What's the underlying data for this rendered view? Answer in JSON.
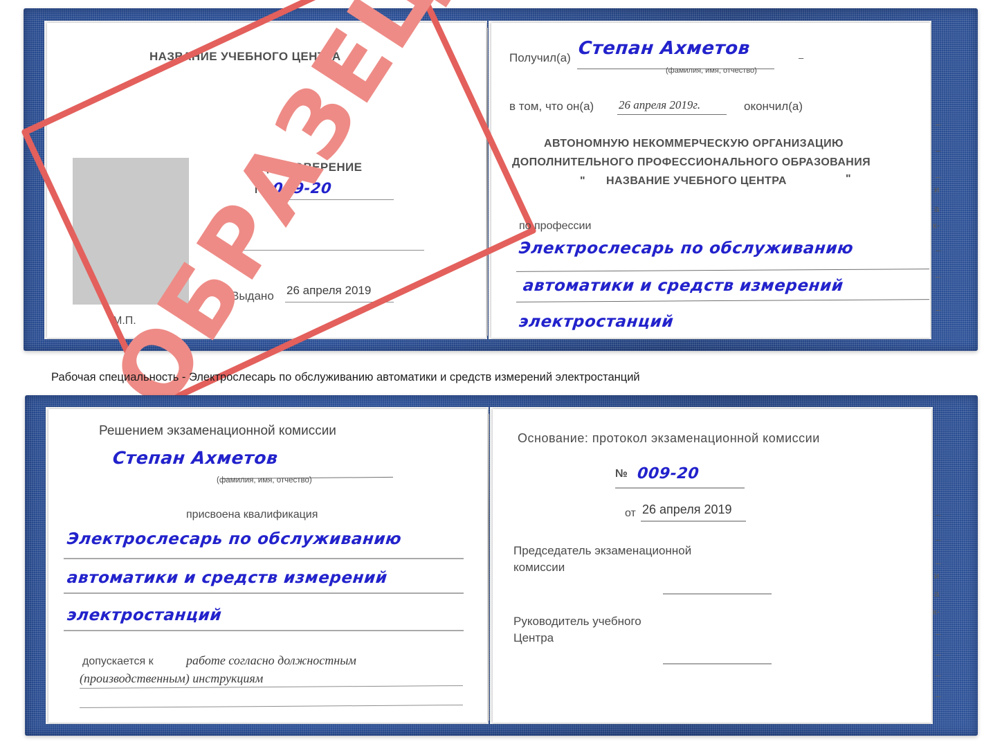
{
  "meta": {
    "document_type": "Удостоверение",
    "stamp_text": "ОБРАЗЕЦ",
    "accent_blue": "#2b5098",
    "stamp_red": "#e3605c",
    "handwriting_blue": "#2222cc"
  },
  "caption": "Рабочая специальность - Электрослесарь по обслуживанию автоматики и средств измерений электростанций",
  "certificate_1": {
    "left_page": {
      "center_name": "НАЗВАНИЕ УЧЕБНОГО ЦЕНТРА",
      "doc_title": "УДОСТОВЕРЕНИЕ",
      "number_label": "№",
      "number_value": "009-20",
      "issued_label": "Выдано",
      "issued_value": "26 апреля 2019",
      "seal_label": "М.П.",
      "photo_placeholder": "photo-placeholder"
    },
    "right_page": {
      "received_label": "Получил(а)",
      "received_value": "Степан Ахметов",
      "fio_hint": "(фамилия, имя, отчество)",
      "in_that_label": "в том, что он(а)",
      "completion_date": "26 апреля 2019г.",
      "finished_label": "окончил(а)",
      "org_line_1": "АВТОНОМНУЮ НЕКОММЕРЧЕСКУЮ ОРГАНИЗАЦИЮ",
      "org_line_2": "ДОПОЛНИТЕЛЬНОГО ПРОФЕССИОНАЛЬНОГО ОБРАЗОВАНИЯ",
      "org_quote_open": "\"",
      "org_line_3": "НАЗВАНИЕ УЧЕБНОГО ЦЕНТРА",
      "org_quote_close": "\"",
      "profession_label": "по профессии",
      "profession_line_1": "Электрослесарь по обслуживанию",
      "profession_line_2": "автоматики и средств измерений",
      "profession_line_3": "электростанций",
      "edge_fragments": [
        "–",
        "–",
        "–",
        "и",
        "а",
        "к-",
        "–",
        "–",
        "–"
      ]
    }
  },
  "certificate_2": {
    "left_page": {
      "decision_label": "Решением экзаменационной комиссии",
      "name_value": "Степан Ахметов",
      "fio_hint": "(фамилия, имя, отчество)",
      "qualification_label": "присвоена квалификация",
      "qualification_line_1": "Электрослесарь по обслуживанию",
      "qualification_line_2": "автоматики и средств измерений",
      "qualification_line_3": "электростанций",
      "admitted_label": "допускается к",
      "admitted_value_1": "работе согласно должностным",
      "admitted_value_2": "(производственным) инструкциям"
    },
    "right_page": {
      "basis_label": "Основание: протокол экзаменационной комиссии",
      "protocol_number_label": "№",
      "protocol_number_value": "009-20",
      "protocol_date_label": "от",
      "protocol_date_value": "26 апреля 2019",
      "chairman_line_1": "Председатель экзаменационной",
      "chairman_line_2": "комиссии",
      "head_line_1": "Руководитель учебного",
      "head_line_2": "Центра",
      "edge_fragments": [
        "–",
        "–",
        "–",
        "и",
        "а",
        "к-",
        "–",
        "–",
        "–",
        "–"
      ]
    }
  }
}
